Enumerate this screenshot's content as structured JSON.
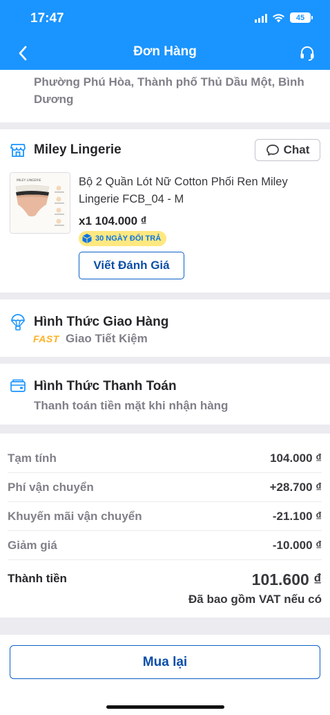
{
  "status_bar": {
    "time": "17:47",
    "battery": "45"
  },
  "header": {
    "title": "Đơn Hàng"
  },
  "address": {
    "lines": [
      "Phường Phú Hòa, Thành phố Thủ Dầu Một, Bình",
      "Dương"
    ]
  },
  "shop": {
    "name": "Miley Lingerie",
    "chat_label": "Chat",
    "product": {
      "name": "Bộ 2 Quần Lót Nữ Cotton Phối Ren Miley Lingerie FCB_04 - M",
      "qty_price": "x1  104.000 ₫",
      "return_badge": "30 NGÀY ĐỔI TRẢ",
      "image_brand": "MILEY LINGERIE"
    },
    "review_label": "Viết Đánh Giá"
  },
  "shipping": {
    "title": "Hình Thức Giao Hàng",
    "badge": "FAST",
    "method": "Giao Tiết Kiệm"
  },
  "payment": {
    "title": "Hình Thức Thanh Toán",
    "method": "Thanh toán tiền mặt khi nhận hàng"
  },
  "summary": {
    "rows": [
      {
        "label": "Tạm tính",
        "value": "104.000 ₫"
      },
      {
        "label": "Phí vận chuyển",
        "value": "+28.700 ₫"
      },
      {
        "label": "Khuyến mãi vận chuyển",
        "value": "-21.100 ₫"
      },
      {
        "label": "Giảm giá",
        "value": "-10.000 ₫"
      }
    ],
    "total_label": "Thành tiền",
    "total_value": "101.600 ₫",
    "vat_note": "Đã bao gồm VAT nếu có"
  },
  "footer": {
    "rebuy_label": "Mua lại"
  },
  "colors": {
    "primary": "#1a94ff",
    "button_border": "#0b5fc7",
    "fast": "#fdb022",
    "badge_bg": "#ffe880"
  }
}
